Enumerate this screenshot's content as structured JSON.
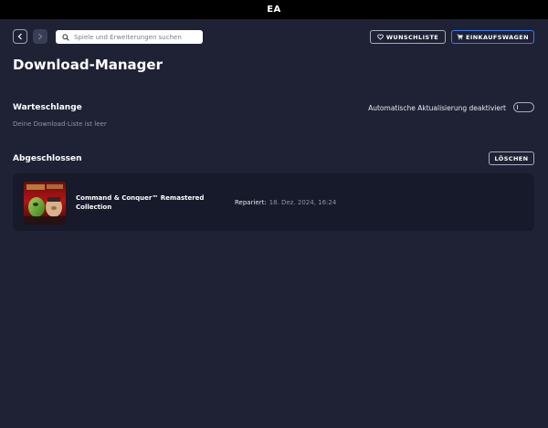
{
  "window": {
    "title": "EA"
  },
  "search": {
    "placeholder": "Spiele und Erweiterungen suchen"
  },
  "header": {
    "wishlist_label": "WUNSCHLISTE",
    "cart_label": "EINKAUFSWAGEN"
  },
  "page": {
    "title": "Download-Manager"
  },
  "queue": {
    "heading": "Warteschlange",
    "empty_text": "Deine Download-Liste ist leer",
    "auto_update_label": "Automatische Aktualisierung deaktiviert",
    "auto_update_enabled": false
  },
  "completed": {
    "heading": "Abgeschlossen",
    "clear_label": "LÖSCHEN",
    "items": [
      {
        "title": "Command & Conquer™ Remastered Collection",
        "status_label": "Repariert:",
        "status_value": "18. Dez. 2024, 16:24"
      }
    ]
  },
  "colors": {
    "background": "#1f2235",
    "card": "#171a2a",
    "accent": "#3d7cf0",
    "titlebar": "#000000"
  },
  "icons": {
    "back": "chevron-left-icon",
    "forward": "chevron-right-icon",
    "search": "search-icon",
    "wishlist": "heart-icon",
    "cart": "cart-icon"
  }
}
